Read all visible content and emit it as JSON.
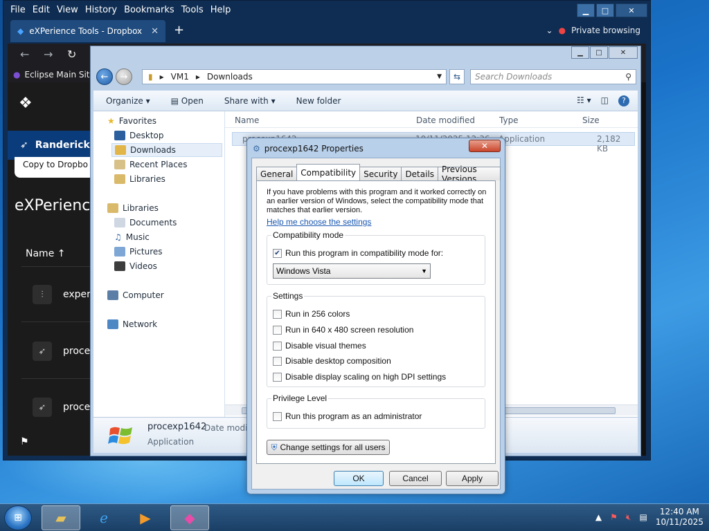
{
  "firefox": {
    "menu": [
      "File",
      "Edit",
      "View",
      "History",
      "Bookmarks",
      "Tools",
      "Help"
    ],
    "tab_title": "eXPerience Tools - Dropbox",
    "private_label": "Private browsing",
    "bookmark": "Eclipse Main Site"
  },
  "dropbox": {
    "banner": "Randerick",
    "copy_button": "Copy to Dropbo",
    "title": "eXPerience",
    "column": "Name",
    "files": [
      {
        "name": "exper",
        "icon": "zip-icon"
      },
      {
        "name": "proce",
        "icon": "rocket-icon"
      },
      {
        "name": "proce",
        "icon": "rocket-icon"
      }
    ]
  },
  "explorer": {
    "path": [
      "VM1",
      "Downloads"
    ],
    "search_placeholder": "Search Downloads",
    "toolbar": {
      "organize": "Organize",
      "open": "Open",
      "share": "Share with",
      "new_folder": "New folder"
    },
    "nav": {
      "favorites": "Favorites",
      "desktop": "Desktop",
      "downloads": "Downloads",
      "recent": "Recent Places",
      "libraries_fav": "Libraries",
      "libraries": "Libraries",
      "documents": "Documents",
      "music": "Music",
      "pictures": "Pictures",
      "videos": "Videos",
      "computer": "Computer",
      "network": "Network"
    },
    "columns": {
      "name": "Name",
      "date": "Date modified",
      "type": "Type",
      "size": "Size"
    },
    "row": {
      "name": "procexp1642",
      "date": "10/11/2025 12:36",
      "type": "Application",
      "size": "2,182 KB"
    },
    "details": {
      "name": "procexp1642",
      "date_label": "Date modifi",
      "type": "Application"
    }
  },
  "dialog": {
    "title": "procexp1642 Properties",
    "tabs": [
      "General",
      "Compatibility",
      "Security",
      "Details",
      "Previous Versions"
    ],
    "intro": "If you have problems with this program and it worked correctly on an earlier version of Windows, select the compatibility mode that matches that earlier version.",
    "help_link": "Help me choose the settings",
    "compat_group": "Compatibility mode",
    "compat_checkbox": "Run this program in compatibility mode for:",
    "compat_selected": "Windows Vista",
    "settings_group": "Settings",
    "settings": [
      "Run in 256 colors",
      "Run in 640 x 480 screen resolution",
      "Disable visual themes",
      "Disable desktop composition",
      "Disable display scaling on high DPI settings"
    ],
    "privilege_group": "Privilege Level",
    "privilege_checkbox": "Run this program as an administrator",
    "change_all": "Change settings for all users",
    "ok": "OK",
    "cancel": "Cancel",
    "apply": "Apply"
  },
  "taskbar": {
    "time": "12:40 AM",
    "date": "10/11/2025"
  }
}
